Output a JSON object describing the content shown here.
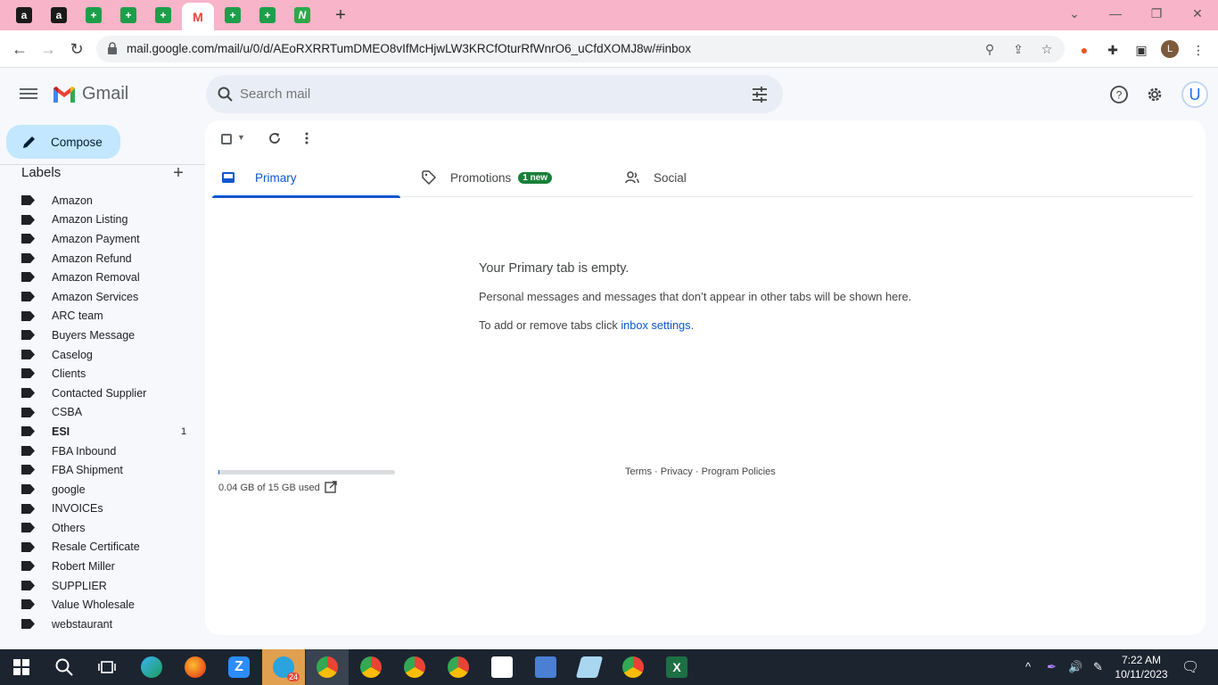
{
  "browser": {
    "tabs": [
      {
        "icon": "amazon-icon",
        "glyph": "a"
      },
      {
        "icon": "amazon-icon",
        "glyph": "a"
      },
      {
        "icon": "sheets-icon",
        "glyph": "+"
      },
      {
        "icon": "sheets-icon",
        "glyph": "+"
      },
      {
        "icon": "sheets-icon",
        "glyph": "+"
      },
      {
        "icon": "gmail-icon",
        "glyph": "M",
        "active": true
      },
      {
        "icon": "sheets-icon",
        "glyph": "+"
      },
      {
        "icon": "sheets-icon",
        "glyph": "+"
      },
      {
        "icon": "app-icon",
        "glyph": "N"
      }
    ],
    "url": "mail.google.com/mail/u/0/d/AEoRXRRTumDMEO8vIfMcHjwLW3KRCfOturRfWnrO6_uCfdXOMJ8w/#inbox",
    "profile_letter": "L"
  },
  "gmail": {
    "app_name": "Gmail",
    "search_placeholder": "Search mail",
    "compose_label": "Compose",
    "avatar_letter": "U",
    "labels_header": "Labels",
    "labels": [
      {
        "name": "Amazon"
      },
      {
        "name": "Amazon Listing"
      },
      {
        "name": "Amazon Payment"
      },
      {
        "name": "Amazon Refund"
      },
      {
        "name": "Amazon Removal"
      },
      {
        "name": "Amazon Services"
      },
      {
        "name": "ARC team"
      },
      {
        "name": "Buyers Message"
      },
      {
        "name": "Caselog"
      },
      {
        "name": "Clients"
      },
      {
        "name": "Contacted Supplier"
      },
      {
        "name": "CSBA"
      },
      {
        "name": "ESI",
        "count": "1",
        "bold": true
      },
      {
        "name": "FBA Inbound"
      },
      {
        "name": "FBA Shipment"
      },
      {
        "name": "google"
      },
      {
        "name": "INVOICEs"
      },
      {
        "name": "Others"
      },
      {
        "name": "Resale Certificate"
      },
      {
        "name": "Robert Miller"
      },
      {
        "name": "SUPPLIER"
      },
      {
        "name": "Value Wholesale"
      },
      {
        "name": "webstaurant"
      }
    ],
    "tabs": {
      "primary": "Primary",
      "promotions": "Promotions",
      "promotions_badge": "1 new",
      "social": "Social"
    },
    "empty": {
      "title": "Your Primary tab is empty.",
      "description": "Personal messages and messages that don’t appear in other tabs will be shown here.",
      "hint_prefix": "To add or remove tabs click ",
      "hint_link": "inbox settings",
      "hint_suffix": "."
    },
    "storage": {
      "text": "0.04 GB of 15 GB used",
      "fraction_used": 0.003
    },
    "footer": {
      "terms": "Terms",
      "sep1": " · ",
      "privacy": "Privacy",
      "sep2": " · ",
      "policies": "Program Policies"
    }
  },
  "taskbar": {
    "time": "7:22 AM",
    "date": "10/11/2023",
    "telegram_badge": "24"
  },
  "colors": {
    "tabstrip": "#f8b4c8",
    "accent_blue": "#0b57d0",
    "compose_bg": "#c2e7ff",
    "badge_green": "#188038"
  }
}
